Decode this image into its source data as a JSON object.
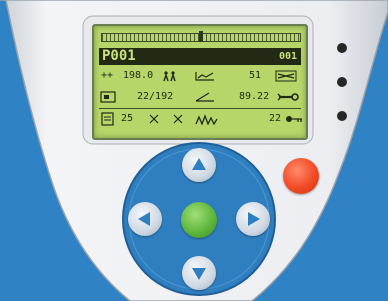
{
  "lcd": {
    "progress": 0.5,
    "program_label": "P001",
    "program_number": "001",
    "rows": [
      {
        "c1": "++",
        "c2": "198.0",
        "c3": "51"
      },
      {
        "c1": "",
        "c2": "22/192",
        "c3": "89.22"
      },
      {
        "c1": "",
        "c2": "25",
        "c3": "22"
      }
    ]
  },
  "colors": {
    "background": "#2f82c4",
    "housing": "#eef0f2",
    "lcd": "#b6d66a",
    "dpad_ring": "#2f7fc0",
    "ok_button": "#5eb83c",
    "stop_button": "#f24a25"
  },
  "controls": {
    "dpad": [
      "up",
      "down",
      "left",
      "right"
    ],
    "center": "ok",
    "side": "stop"
  }
}
